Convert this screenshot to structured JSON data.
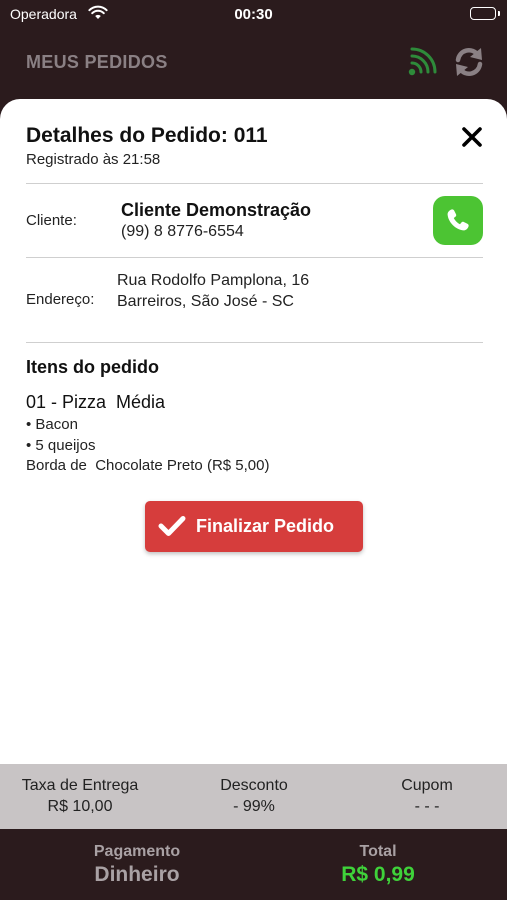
{
  "status_bar": {
    "carrier": "Operadora",
    "time": "00:30"
  },
  "header": {
    "title": "MEUS PEDIDOS",
    "signal_color": "#2e8b3a"
  },
  "order": {
    "title": "Detalhes do Pedido: 011",
    "registered": "Registrado às 21:58",
    "client_label": "Cliente:",
    "client_name": "Cliente Demonstração",
    "client_phone": "(99) 8 8776-6554",
    "address_label": "Endereço:",
    "address_line1": "Rua Rodolfo Pamplona, 16",
    "address_line2": "Barreiros, São José - SC",
    "items_title": "Itens do pedido",
    "items": [
      {
        "name": "01 - Pizza  Média",
        "options": [
          "• Bacon",
          "• 5 queijos"
        ],
        "border": "Borda de  Chocolate Preto (R$ 5,00)"
      }
    ],
    "finalize_label": "Finalizar Pedido"
  },
  "summary": {
    "delivery_label": "Taxa de Entrega",
    "delivery_value": "R$ 10,00",
    "discount_label": "Desconto",
    "discount_value": "- 99%",
    "coupon_label": "Cupom",
    "coupon_value": "- - -"
  },
  "footer": {
    "payment_label": "Pagamento",
    "payment_value": "Dinheiro",
    "total_label": "Total",
    "total_value": "R$ 0,99"
  },
  "colors": {
    "header_bg": "#2b1b1d",
    "call_button": "#4cc433",
    "finalize_button": "#d63d3c",
    "total_value": "#3fd23a",
    "summary_bg": "#c8c4c5"
  }
}
